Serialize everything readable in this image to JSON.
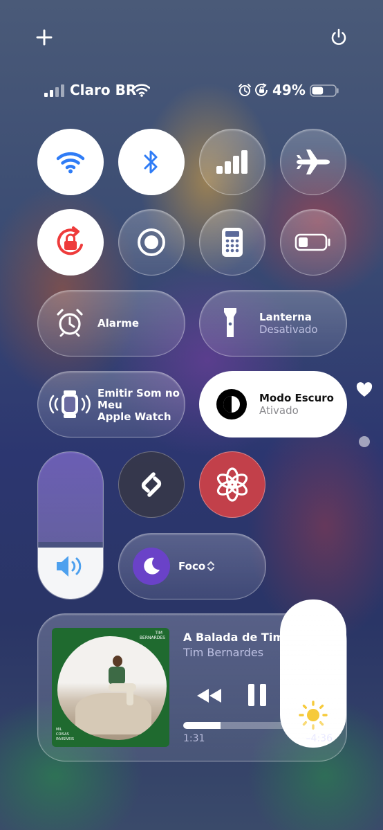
{
  "status_bar": {
    "carrier": "Claro BR",
    "battery_percent": "49%",
    "battery_level": 0.49
  },
  "icons": {
    "add": "plus-icon",
    "power": "power-icon",
    "wifi": "wifi-icon",
    "bluetooth": "bluetooth-icon",
    "cellular": "cellular-signal-icon",
    "airplane": "airplane-icon",
    "orientation_lock": "orientation-lock-icon",
    "screen_record": "screen-record-icon",
    "calculator": "calculator-icon",
    "low_power": "battery-icon",
    "alarm": "alarm-clock-icon",
    "flashlight": "flashlight-icon",
    "watch_ping": "apple-watch-ping-icon",
    "dark_mode": "dark-mode-icon",
    "shazam": "shazam-icon",
    "chatgpt": "chatgpt-icon",
    "volume": "speaker-icon",
    "focus": "moon-icon",
    "brightness": "sun-icon",
    "favorite": "heart-icon",
    "airplay": "airplay-audio-icon",
    "rewind": "rewind-icon",
    "pause": "pause-icon",
    "forward": "fast-forward-icon"
  },
  "controls": {
    "alarm_label": "Alarme",
    "flashlight_label": "Lanterna",
    "flashlight_status": "Desativado",
    "watch_label_1": "Emitir Som no",
    "watch_label_2": "Meu",
    "watch_label_3": "Apple Watch",
    "dark_mode_label": "Modo Escuro",
    "dark_mode_status": "Ativado",
    "focus_label": "Foco",
    "volume_level": 0.35,
    "brightness_level": 0.35
  },
  "now_playing": {
    "title": "A Balada de Tim Bernardes",
    "artist": "Tim Bernardes",
    "elapsed": "1:31",
    "remaining": "–4:36",
    "progress": 0.25,
    "album_art_top_text_1": "TIM",
    "album_art_top_text_2": "BERNARDES",
    "album_art_bottom_text_1": "MIL",
    "album_art_bottom_text_2": "COISAS",
    "album_art_bottom_text_3": "INVISÍVEIS"
  },
  "colors": {
    "accent_blue": "#2f7cf6",
    "lock_red": "#ee3b3b",
    "album_green": "#1f6a2f",
    "chatgpt_bg": "#c2404a"
  }
}
